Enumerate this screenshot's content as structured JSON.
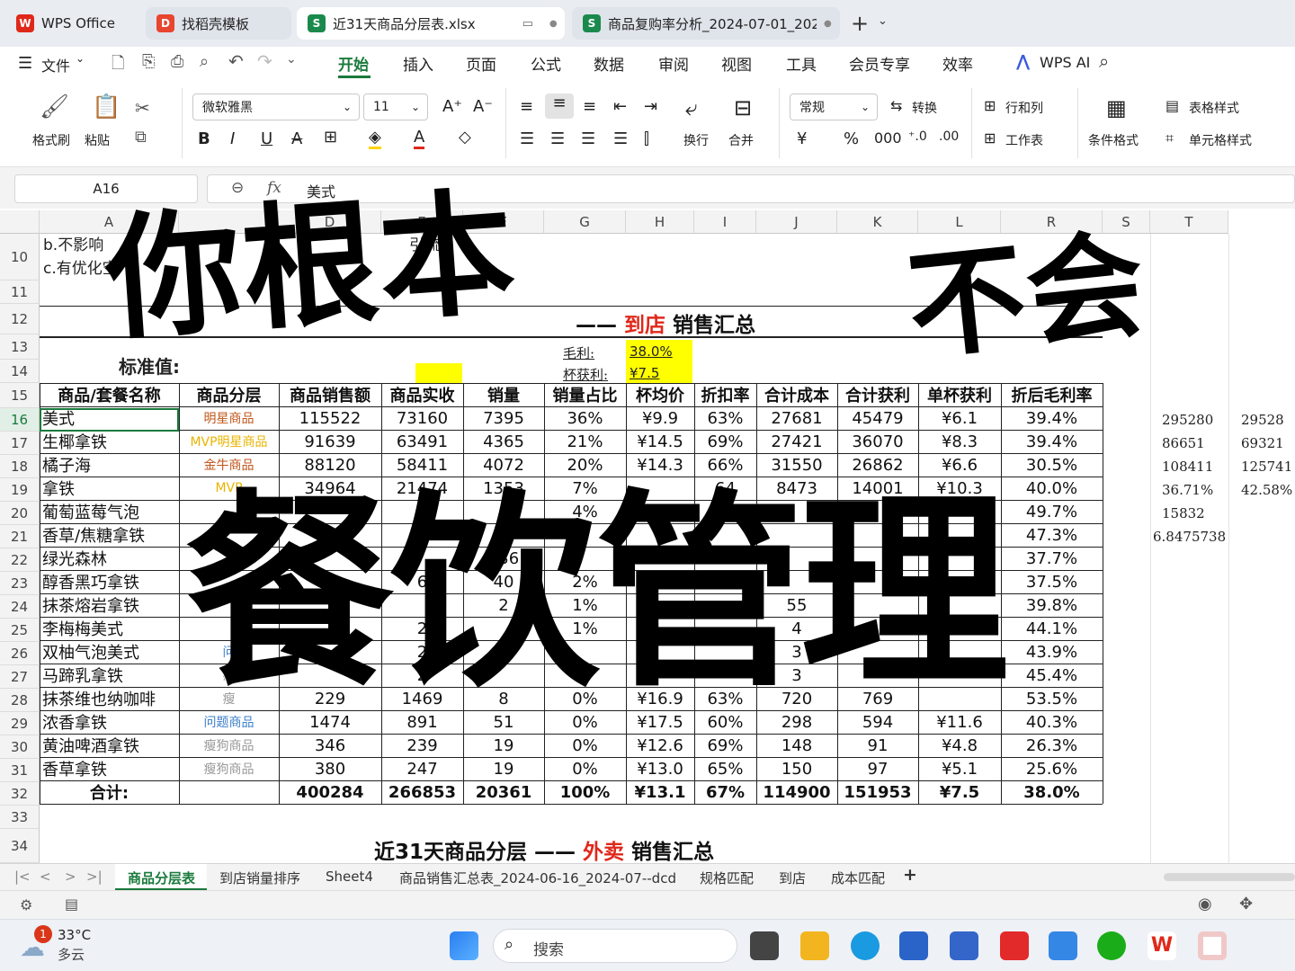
{
  "tabs": [
    {
      "label": "WPS Office"
    },
    {
      "label": "找稻壳模板"
    },
    {
      "label": "近31天商品分层表.xlsx"
    },
    {
      "label": "商品复购率分析_2024-07-01_202"
    }
  ],
  "menu": {
    "file": "文件",
    "items": [
      "开始",
      "插入",
      "页面",
      "公式",
      "数据",
      "审阅",
      "视图",
      "工具",
      "会员专享",
      "效率"
    ],
    "ai": "WPS AI"
  },
  "ribbon": {
    "format_painter": "格式刷",
    "paste": "粘贴",
    "font_name": "微软雅黑",
    "font_size": "11",
    "wrap": "换行",
    "merge": "合并",
    "number_format": "常规",
    "convert": "转换",
    "row_col": "行和列",
    "worksheet": "工作表",
    "cond_format": "条件格式",
    "table_style": "表格样式",
    "cell_style": "单元格样式"
  },
  "formula_bar": {
    "cell_ref": "A16",
    "fx": "fx",
    "content": "美式"
  },
  "columns": [
    "A",
    "",
    "D",
    "E",
    "F",
    "G",
    "H",
    "I",
    "J",
    "K",
    "L",
    "R",
    "S",
    "T"
  ],
  "rows": [
    "10",
    "11",
    "12",
    "13",
    "14",
    "15",
    "16",
    "17",
    "18",
    "19",
    "20",
    "21",
    "22",
    "23",
    "24",
    "25",
    "26",
    "27",
    "28",
    "29",
    "30",
    "31",
    "32",
    "33",
    "34"
  ],
  "sheet": {
    "top_texts": [
      "b.不影响",
      "引流;",
      "c.有优化空"
    ],
    "title1": {
      "pre": "—— ",
      "red": "到店",
      "post": " 销售汇总"
    },
    "standard_label": "标准值:",
    "std_items": [
      {
        "label": "毛利:",
        "value": "38.0%"
      },
      {
        "label": "杯获利:",
        "value": "¥7.5"
      }
    ],
    "headers": [
      "商品/套餐名称",
      "商品分层",
      "商品销售额",
      "商品实收",
      "销量",
      "销量占比",
      "杯均价",
      "折扣率",
      "合计成本",
      "合计获利",
      "单杯获利",
      "折后毛利率"
    ],
    "rows": [
      [
        "美式",
        "明星商品",
        "115522",
        "73160",
        "7395",
        "36%",
        "¥9.9",
        "63%",
        "27681",
        "45479",
        "¥6.1",
        "39.4%"
      ],
      [
        "生椰拿铁",
        "MVP明星商品",
        "91639",
        "63491",
        "4365",
        "21%",
        "¥14.5",
        "69%",
        "27421",
        "36070",
        "¥8.3",
        "39.4%"
      ],
      [
        "橘子海",
        "金牛商品",
        "88120",
        "58411",
        "4072",
        "20%",
        "¥14.3",
        "66%",
        "31550",
        "26862",
        "¥6.6",
        "30.5%"
      ],
      [
        "拿铁",
        "MVP",
        "34964",
        "21474",
        "1353",
        "7%",
        "",
        "64",
        "8473",
        "14001",
        "¥10.3",
        "40.0%"
      ],
      [
        "葡萄蓝莓气泡",
        "",
        "",
        "",
        "",
        "4%",
        "",
        "",
        "",
        "",
        "",
        "49.7%"
      ],
      [
        "香草/焦糖拿铁",
        "",
        "",
        "",
        "",
        "",
        "",
        "",
        "",
        "",
        "",
        "47.3%"
      ],
      [
        "绿光森林",
        "",
        "",
        "",
        "436",
        "",
        "",
        "",
        "",
        "",
        "",
        "37.7%"
      ],
      [
        "醇香黑巧拿铁",
        "",
        "",
        "6",
        "40",
        "2%",
        "",
        "",
        "",
        "",
        "",
        "37.5%"
      ],
      [
        "抹茶熔岩拿铁",
        "",
        "",
        "",
        "2",
        "1%",
        "",
        "",
        "55",
        "",
        "",
        "39.8%"
      ],
      [
        "李梅梅美式",
        "",
        "",
        "2",
        "",
        "1%",
        "",
        "",
        "4",
        "",
        "",
        "44.1%"
      ],
      [
        "双柚气泡美式",
        "问",
        "",
        "2",
        "",
        "",
        "",
        "",
        "3",
        "",
        "",
        "43.9%"
      ],
      [
        "马蹄乳拿铁",
        "瘦",
        "",
        "2",
        "",
        "",
        "",
        "",
        "3",
        "",
        "",
        "45.4%"
      ],
      [
        "抹茶维也纳咖啡",
        "瘦",
        "229",
        "1469",
        "8",
        "0%",
        "¥16.9",
        "63%",
        "720",
        "769",
        "",
        "53.5%"
      ],
      [
        "浓香拿铁",
        "问题商品",
        "1474",
        "891",
        "51",
        "0%",
        "¥17.5",
        "60%",
        "298",
        "594",
        "¥11.6",
        "40.3%"
      ],
      [
        "黄油啤酒拿铁",
        "瘦狗商品",
        "346",
        "239",
        "19",
        "0%",
        "¥12.6",
        "69%",
        "148",
        "91",
        "¥4.8",
        "26.3%"
      ],
      [
        "香草拿铁",
        "瘦狗商品",
        "380",
        "247",
        "19",
        "0%",
        "¥13.0",
        "65%",
        "150",
        "97",
        "¥5.1",
        "25.6%"
      ]
    ],
    "total": [
      "合计:",
      "",
      "400284",
      "266853",
      "20361",
      "100%",
      "¥13.1",
      "67%",
      "114900",
      "151953",
      "¥7.5",
      "38.0%"
    ],
    "title2": {
      "pre": "近31天商品分层 —— ",
      "red": "外卖",
      "post": " 销售汇总"
    },
    "side_s": [
      "295280",
      "86651",
      "108411",
      "36.71%",
      "15832",
      "6.8475738"
    ],
    "side_t": [
      "29528",
      "69321",
      "125741",
      "42.58%"
    ]
  },
  "overlay": {
    "line1a": "你根本",
    "line1b": "不会",
    "line2": "餐饮管理"
  },
  "sheet_tabs": [
    "商品分层表",
    "到店销量排序",
    "Sheet4",
    "商品销售汇总表_2024-06-16_2024-07--dcd",
    "规格匹配",
    "到店",
    "成本匹配"
  ],
  "taskbar": {
    "temp": "33°C",
    "weather": "多云",
    "search": "搜索",
    "badge": "1"
  },
  "colors": {
    "accent": "#1a7a3c",
    "red": "#e0281a",
    "tier_gold": "#e8b400",
    "tier_blue": "#3d7fc9",
    "tier_gray": "#999999",
    "highlight": "#ffff00"
  }
}
